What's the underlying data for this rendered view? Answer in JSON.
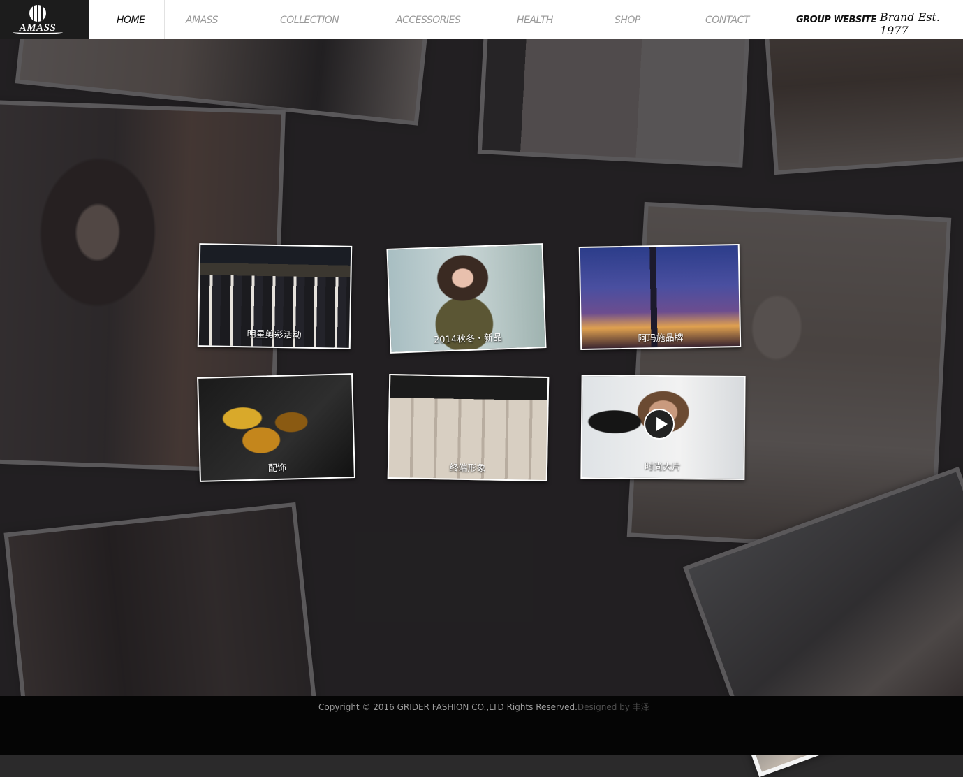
{
  "logo": {
    "text": "AMASS"
  },
  "nav": [
    {
      "label": "HOME"
    },
    {
      "label": "AMASS"
    },
    {
      "label": "COLLECTION"
    },
    {
      "label": "ACCESSORIES"
    },
    {
      "label": "HEALTH"
    },
    {
      "label": "SHOP"
    },
    {
      "label": "CONTACT"
    }
  ],
  "group_website": "GROUP WEBSITE",
  "brand_est": "Brand Est. 1977",
  "tiles": [
    {
      "caption": "明星剪彩活动"
    },
    {
      "caption": "2014秋冬・新品"
    },
    {
      "caption": "阿玛施品牌"
    },
    {
      "caption": "配饰"
    },
    {
      "caption": "终端形象"
    },
    {
      "caption": "时尚大片"
    }
  ],
  "footer": {
    "copyright": "Copyright © 2016 GRIDER FASHION CO.,LTD Rights Reserved.",
    "designed": "Designed by 丰泽"
  },
  "colors": {
    "topbar": "#ffffff",
    "logo_bg": "#1c1c1c",
    "page_bg": "#2b2a2b",
    "footer_bg": "#050505"
  }
}
